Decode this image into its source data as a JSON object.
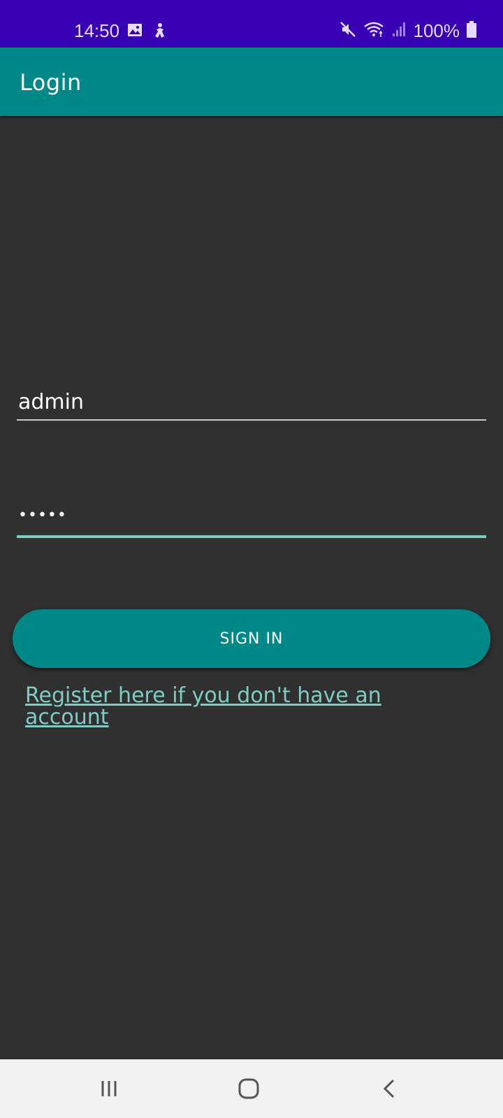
{
  "status_bar": {
    "time": "14:50",
    "battery": "100%",
    "icons": [
      "image-icon",
      "accessibility-icon",
      "mute-icon",
      "wifi-icon",
      "signal-icon",
      "battery-icon"
    ]
  },
  "app_bar": {
    "title": "Login"
  },
  "form": {
    "username_value": "admin",
    "password_value": "•••••",
    "signin_label": "SIGN IN",
    "register_link": "Register here if you don't have an account"
  },
  "nav_bar": {
    "icons": [
      "recent-apps-icon",
      "home-icon",
      "back-icon"
    ]
  },
  "colors": {
    "status_bar": "#3700b3",
    "primary": "#008888",
    "background": "#303030",
    "accent": "#80cbc4",
    "nav_bar": "#f2f2f2"
  }
}
